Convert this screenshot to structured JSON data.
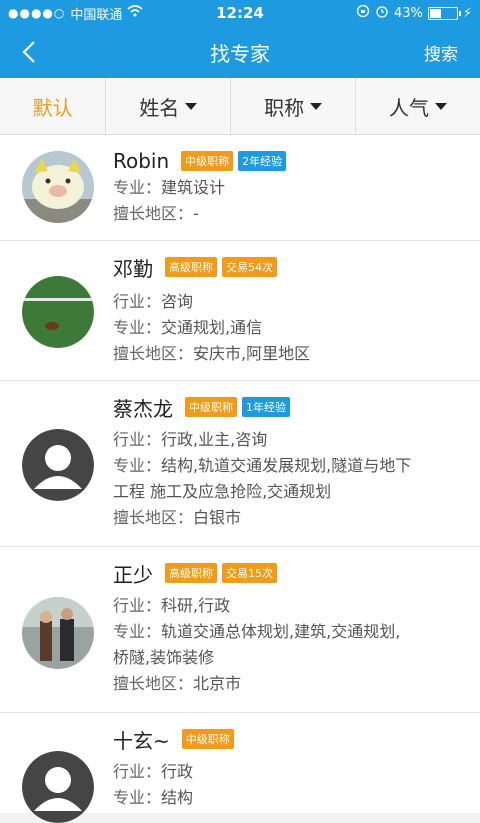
{
  "status": {
    "carrier": "中国联通",
    "time": "12:24",
    "battery": "43%"
  },
  "nav": {
    "title": "找专家",
    "search": "搜索"
  },
  "filters": [
    "默认",
    "姓名",
    "职称",
    "人气"
  ],
  "experts": [
    {
      "name": "Robin",
      "tags": [
        {
          "text": "中级职称",
          "color": "orange"
        },
        {
          "text": "2年经验",
          "color": "blue"
        }
      ],
      "lines": [
        [
          "专业：",
          "建筑设计"
        ],
        [
          "擅长地区：",
          "-"
        ]
      ]
    },
    {
      "name": "邓勤",
      "tags": [
        {
          "text": "高级职称",
          "color": "orange"
        },
        {
          "text": "交易54次",
          "color": "orange"
        }
      ],
      "lines": [
        [
          "行业：",
          "咨询"
        ],
        [
          "专业：",
          "交通规划,通信"
        ],
        [
          "擅长地区：",
          "安庆市,阿里地区"
        ]
      ]
    },
    {
      "name": "蔡杰龙",
      "tags": [
        {
          "text": "中级职称",
          "color": "orange"
        },
        {
          "text": "1年经验",
          "color": "blue"
        }
      ],
      "lines": [
        [
          "行业：",
          "行政,业主,咨询"
        ],
        [
          "专业：",
          "结构,轨道交通发展规划,隧道与地下"
        ],
        [
          "",
          "工程 施工及应急抢险,交通规划"
        ],
        [
          "擅长地区：",
          "白银市"
        ]
      ]
    },
    {
      "name": "正少",
      "tags": [
        {
          "text": "高级职称",
          "color": "orange"
        },
        {
          "text": "交易15次",
          "color": "orange"
        }
      ],
      "lines": [
        [
          "行业：",
          "科研,行政"
        ],
        [
          "专业：",
          "轨道交通总体规划,建筑,交通规划,"
        ],
        [
          "",
          "桥隧,装饰装修"
        ],
        [
          "擅长地区：",
          "北京市"
        ]
      ]
    },
    {
      "name": "十玄~",
      "tags": [
        {
          "text": "中级职称",
          "color": "orange"
        }
      ],
      "lines": [
        [
          "行业：",
          "行政"
        ],
        [
          "专业：",
          "结构"
        ]
      ]
    }
  ]
}
